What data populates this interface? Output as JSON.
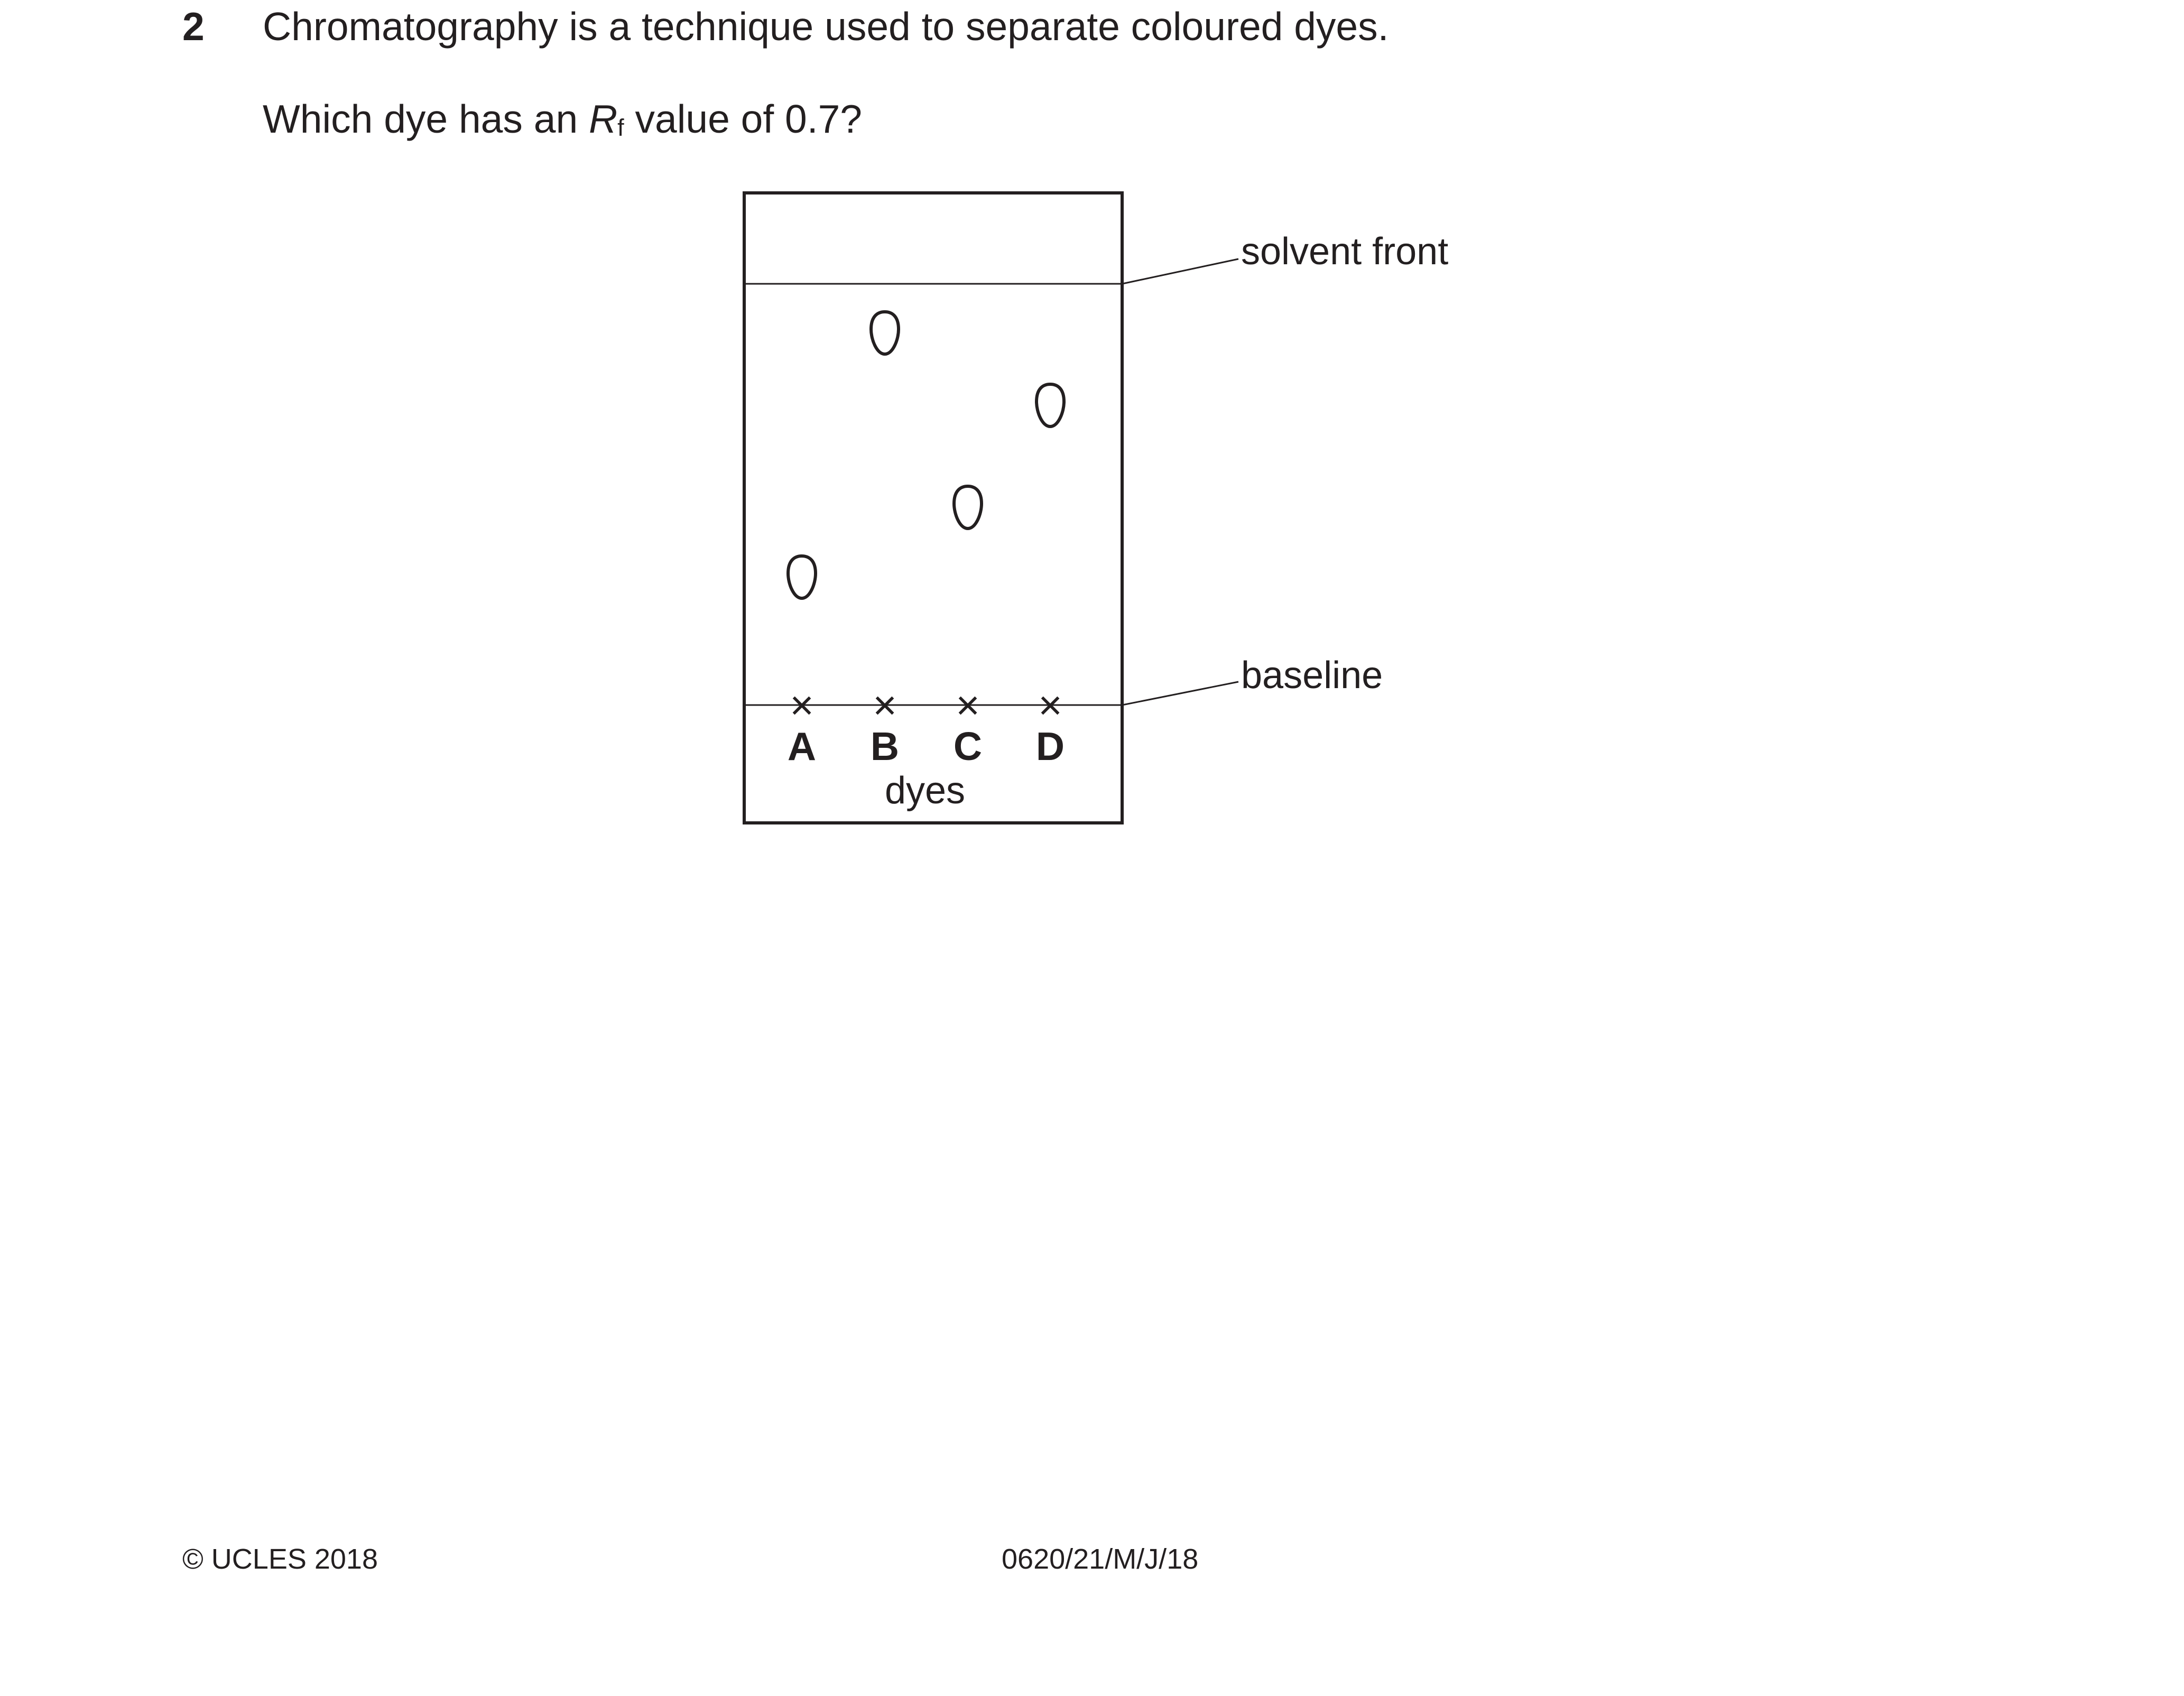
{
  "question": {
    "number": "2",
    "statement": "Chromatography is a technique used to separate coloured dyes.",
    "prompt_before": "Which dye has an ",
    "rf_symbol": "R",
    "rf_subscript": "f",
    "prompt_after": " value of 0.7?"
  },
  "diagram": {
    "solvent_front_label": "solvent front",
    "baseline_label": "baseline",
    "baseline_mark": "×",
    "dyes_label": "dyes",
    "dyes": [
      {
        "letter": "A"
      },
      {
        "letter": "B"
      },
      {
        "letter": "C"
      },
      {
        "letter": "D"
      }
    ]
  },
  "footer": {
    "copyright": "© UCLES 2018",
    "code": "0620/21/M/J/18"
  }
}
